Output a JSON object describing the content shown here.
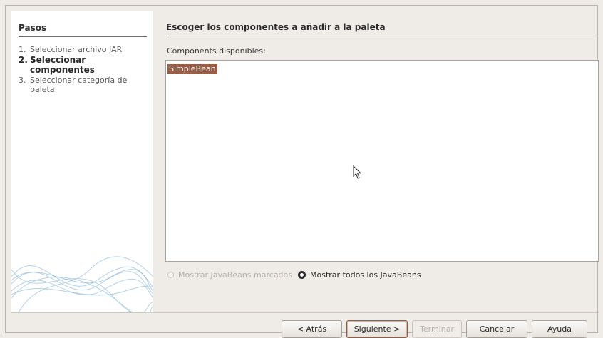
{
  "steps_panel": {
    "title": "Pasos",
    "steps": [
      {
        "num": "1.",
        "label": "Seleccionar archivo JAR",
        "active": false
      },
      {
        "num": "2.",
        "label": "Seleccionar componentes",
        "active": true
      },
      {
        "num": "3.",
        "label": "Seleccionar categoría de paleta",
        "active": false
      }
    ]
  },
  "content": {
    "title": "Escoger los componentes a añadir a la paleta",
    "list_label": "Components disponibles:",
    "list_items": [
      {
        "label": "SimpleBean",
        "selected": true
      }
    ]
  },
  "radios": {
    "marked": "Mostrar JavaBeans marcados",
    "all": "Mostrar todos los JavaBeans",
    "selected": "all"
  },
  "buttons": {
    "back": "< Atrás",
    "next": "Siguiente >",
    "finish": "Terminar",
    "cancel": "Cancelar",
    "help": "Ayuda"
  },
  "colors": {
    "selection": "#9c5b43",
    "background": "#efebe7"
  }
}
